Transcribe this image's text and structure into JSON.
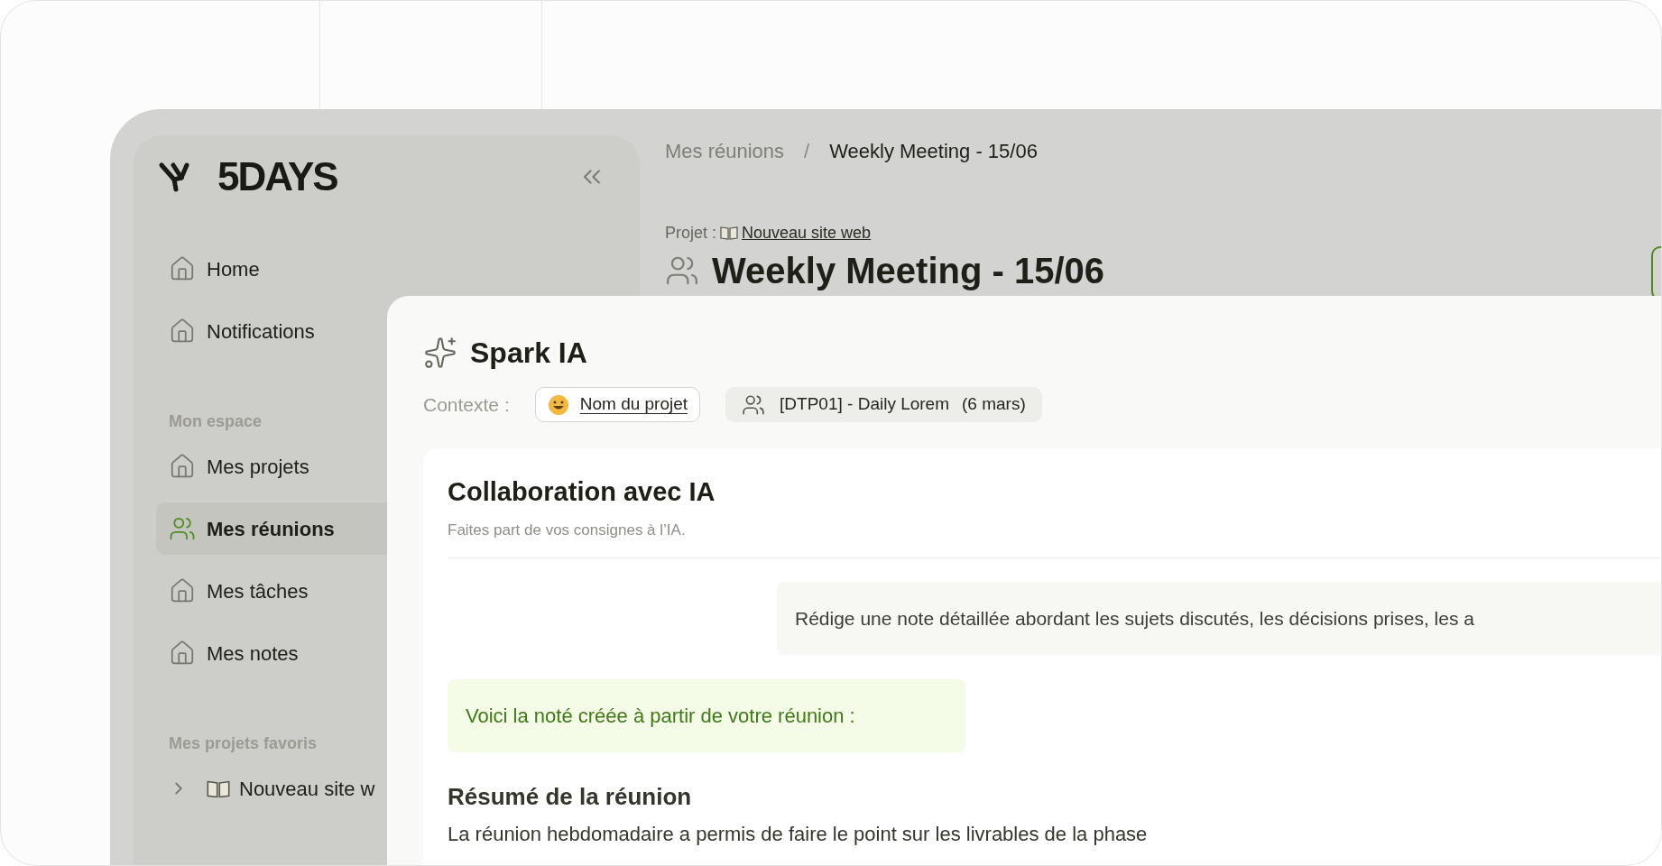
{
  "sidebar": {
    "brand": "5DAYS",
    "nav": [
      {
        "label": "Home",
        "kind": "home",
        "selected": false
      },
      {
        "label": "Notifications",
        "kind": "home",
        "selected": false
      }
    ],
    "sections": [
      {
        "title": "Mon espace",
        "items": [
          {
            "label": "Mes projets",
            "kind": "home",
            "selected": false
          },
          {
            "label": "Mes réunions",
            "kind": "meetings",
            "selected": true
          },
          {
            "label": "Mes tâches",
            "kind": "home",
            "selected": false
          },
          {
            "label": "Mes notes",
            "kind": "home",
            "selected": false
          }
        ]
      },
      {
        "title": "Mes projets favoris",
        "favorites": [
          {
            "label": "Nouveau site w",
            "expanded": false
          }
        ]
      }
    ]
  },
  "main": {
    "breadcrumb": [
      "Mes réunions",
      "/",
      "Weekly Meeting - 15/06"
    ],
    "project_label": "Projet :",
    "project_link": "Nouveau site web",
    "title": "Weekly Meeting - 15/06"
  },
  "modal": {
    "title": "Spark IA",
    "context_label": "Contexte :",
    "chips": [
      {
        "kind": "project",
        "label": "Nom du projet"
      },
      {
        "kind": "meeting",
        "label": "[DTP01] - Daily Lorem",
        "date": "(6 mars)"
      }
    ],
    "card": {
      "title": "Collaboration avec IA",
      "subtitle": "Faites part de vos consignes à l’IA.",
      "messages": [
        {
          "kind": "user",
          "text": "Rédige une note détaillée abordant les sujets discutés, les décisions prises, les a"
        },
        {
          "kind": "assistant",
          "text": "Voici la noté créée à partir de votre réunion :"
        }
      ],
      "summary_title": "Résumé de la réunion",
      "summary_text": "La réunion hebdomadaire a permis de faire le point sur les livrables de la phase"
    }
  }
}
